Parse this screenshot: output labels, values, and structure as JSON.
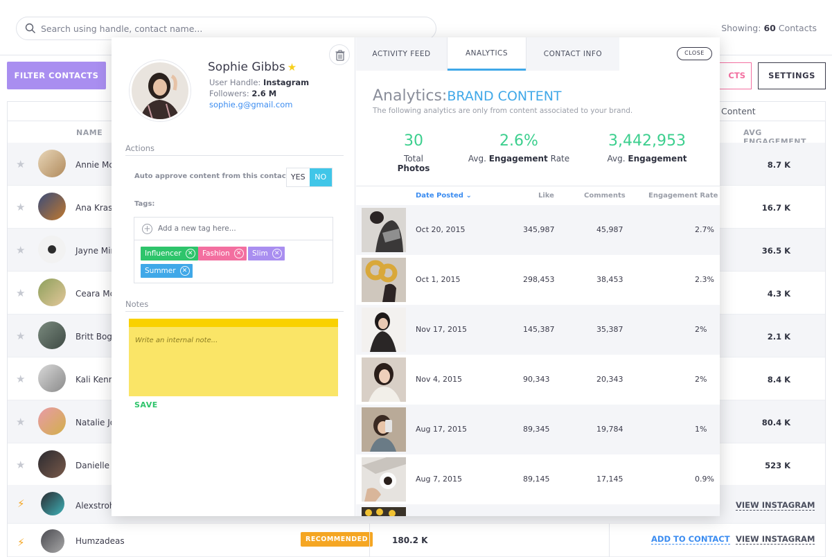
{
  "topbar": {
    "search_placeholder": "Search using handle, contact name...",
    "showing_label": "Showing:",
    "showing_count": "60",
    "showing_suffix": "Contacts"
  },
  "buttons": {
    "filter": "FILTER CONTACTS",
    "contacts_partial": "CTS",
    "settings": "SETTINGS"
  },
  "table": {
    "content_header": "Content",
    "name_header": "NAME",
    "avg_header": "AVG ENGAGEMENT",
    "rows": [
      {
        "name": "Annie Mc",
        "engagement": "8.7 K"
      },
      {
        "name": "Ana Kras",
        "engagement": "16.7 K"
      },
      {
        "name": "Jayne Min",
        "engagement": "36.5 K"
      },
      {
        "name": "Ceara Mc",
        "engagement": "4.3 K"
      },
      {
        "name": "Britt Boga",
        "engagement": "2.1 K"
      },
      {
        "name": "Kali Kenne",
        "engagement": "8.4 K"
      },
      {
        "name": "Natalie Jo",
        "engagement": "80.4 K"
      },
      {
        "name": "Danielle M",
        "engagement": "523 K"
      }
    ],
    "suggested": [
      {
        "name": "Alexstrohl",
        "view": "VIEW INSTAGRAM"
      },
      {
        "name": "Humzadeas",
        "badge": "RECOMMENDED",
        "followers": "180.2 K",
        "add": "ADD TO CONTACT",
        "view": "VIEW INSTAGRAM"
      }
    ]
  },
  "profile": {
    "name": "Sophie Gibbs",
    "handle_label": "User Handle:",
    "handle_value": "Instagram",
    "followers_label": "Followers:",
    "followers_value": "2.6 M",
    "email": "sophie.g@gmail.com"
  },
  "actions": {
    "title": "Actions",
    "auto_approve_label": "Auto approve content from this contact:",
    "yes": "YES",
    "no": "NO",
    "tags_label": "Tags:",
    "add_tag_placeholder": "Add a new tag here...",
    "tags": [
      {
        "label": "Influencer",
        "color": "#2ec46b"
      },
      {
        "label": "Fashion",
        "color": "#f36fa0"
      },
      {
        "label": "Slim",
        "color": "#a98ef0"
      },
      {
        "label": "Summer",
        "color": "#40a8e8"
      }
    ]
  },
  "notes": {
    "title": "Notes",
    "placeholder": "Write an internal note...",
    "save": "SAVE"
  },
  "tabs": [
    {
      "label": "ACTIVITY FEED",
      "active": false
    },
    {
      "label": "ANALYTICS",
      "active": true
    },
    {
      "label": "CONTACT INFO",
      "active": false
    }
  ],
  "close": "CLOSE",
  "analytics": {
    "title_prefix": "Analytics:",
    "title_brand": "BRAND CONTENT",
    "subtitle": "The following analytics are only from content associated to your brand.",
    "stats": [
      {
        "value": "30",
        "pre": "Total",
        "bold": "Photos",
        "post": ""
      },
      {
        "value": "2.6%",
        "pre": "Avg.",
        "bold": "Engagement",
        "post": "Rate"
      },
      {
        "value": "3,442,953",
        "pre": "Avg.",
        "bold": "Engagement",
        "post": ""
      }
    ],
    "columns": {
      "date": "Date Posted",
      "like": "Like",
      "comments": "Comments",
      "rate": "Engagement Rate"
    },
    "posts": [
      {
        "date": "Oct 20, 2015",
        "like": "345,987",
        "comments": "45,987",
        "rate": "2.7%"
      },
      {
        "date": "Oct 1, 2015",
        "like": "298,453",
        "comments": "38,453",
        "rate": "2.3%"
      },
      {
        "date": "Nov 17, 2015",
        "like": "145,387",
        "comments": "35,387",
        "rate": "2%"
      },
      {
        "date": "Nov 4, 2015",
        "like": "90,343",
        "comments": "20,343",
        "rate": "2%"
      },
      {
        "date": "Aug 17, 2015",
        "like": "89,345",
        "comments": "19,784",
        "rate": "1%"
      },
      {
        "date": "Aug 7, 2015",
        "like": "89,145",
        "comments": "17,145",
        "rate": "0.9%"
      }
    ]
  },
  "colors": {
    "accent_blue": "#40a8e8",
    "accent_green": "#3ccf8e",
    "accent_purple": "#a98ef0",
    "accent_pink": "#f36fa0",
    "accent_orange": "#f5a623"
  }
}
